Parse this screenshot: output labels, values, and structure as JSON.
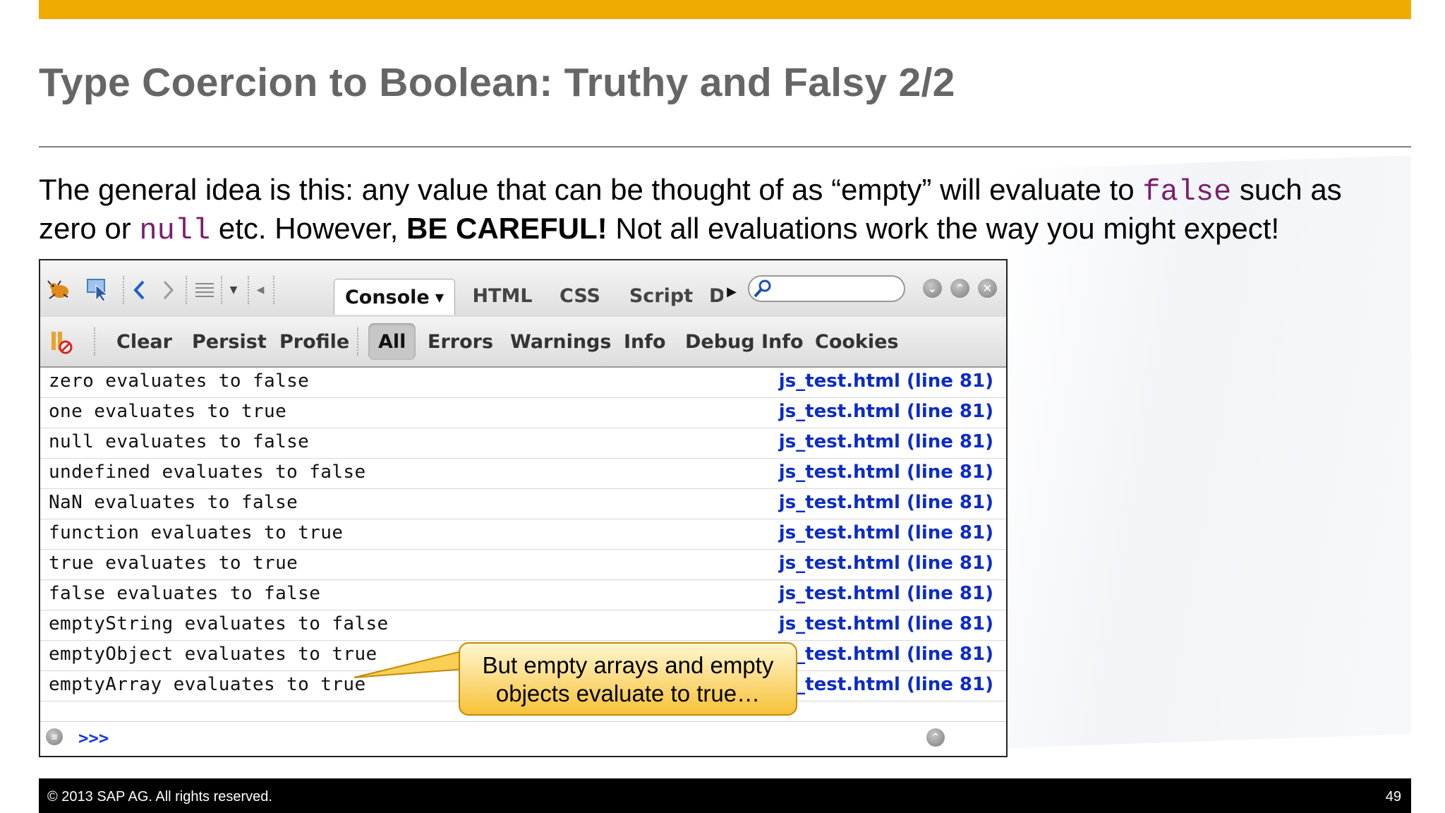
{
  "slide": {
    "title": "Type Coercion to Boolean: Truthy and Falsy 2/2",
    "body_line1_a": "The general idea is this: any value that can be thought of as “empty” will evaluate to ",
    "body_line1_code": "false",
    "body_line1_b": " such as",
    "body_line2_a": "zero or ",
    "body_line2_code": "null",
    "body_line2_b": " etc.  However, ",
    "body_line2_bold": "BE CAREFUL!",
    "body_line2_c": "  Not all evaluations work the way you might expect!"
  },
  "firebug": {
    "tabs": [
      "HTML",
      "CSS",
      "Script",
      "D"
    ],
    "console_tab": "Console",
    "search_placeholder": "",
    "sub_toolbar": {
      "clear": "Clear",
      "persist": "Persist",
      "profile": "Profile",
      "all": "All",
      "errors": "Errors",
      "warnings": "Warnings",
      "info": "Info",
      "debug_info": "Debug Info",
      "cookies": "Cookies"
    },
    "log": [
      {
        "msg": "zero evaluates to false",
        "src": "js_test.html (line 81)"
      },
      {
        "msg": "one evaluates to true",
        "src": "js_test.html (line 81)"
      },
      {
        "msg": "null evaluates to false",
        "src": "js_test.html (line 81)"
      },
      {
        "msg": "undefined evaluates to false",
        "src": "js_test.html (line 81)"
      },
      {
        "msg": "NaN evaluates to false",
        "src": "js_test.html (line 81)"
      },
      {
        "msg": "function evaluates to true",
        "src": "js_test.html (line 81)"
      },
      {
        "msg": "true evaluates to true",
        "src": "js_test.html (line 81)"
      },
      {
        "msg": "false evaluates to false",
        "src": "js_test.html (line 81)"
      },
      {
        "msg": "emptyString evaluates to false",
        "src": "js_test.html (line 81)"
      },
      {
        "msg": "emptyObject evaluates to true",
        "src": "js_test.html (line 81)"
      },
      {
        "msg": "emptyArray evaluates to true",
        "src": "js_test.html (line 81)"
      }
    ],
    "prompt": ">>>"
  },
  "callout": {
    "line1": "But empty arrays and empty",
    "line2": "objects evaluate to true…"
  },
  "footer": {
    "copyright": "©  2013 SAP AG. All rights reserved.",
    "page_number": "49"
  },
  "colors": {
    "accent_bar": "#f0ab00",
    "title": "#666666",
    "code": "#7a1e6e",
    "link": "#0b2bc7"
  }
}
